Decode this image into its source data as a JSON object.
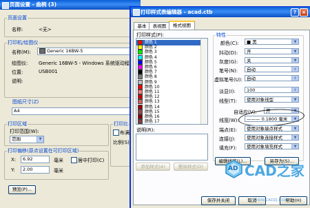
{
  "bg_window": {
    "title": "页面设置 - 曲柄 (3)",
    "page_setup": {
      "group_label": "页面设置",
      "name_label": "名称:",
      "name_value": "<无>"
    },
    "printer": {
      "group_label": "打印机/绘图仪",
      "name_label": "名称(M):",
      "name_value": "Generic 16BW-5",
      "plotter_label": "绘图仪:",
      "plotter_value": "Generic 16BW-5 - Windows 系统驱动程序 -",
      "location_label": "位置:",
      "location_value": "USB001",
      "desc_label": "说明:"
    },
    "paper_size": {
      "group_label": "图纸尺寸(Z)",
      "value": "A4"
    },
    "plot_area": {
      "group_label": "打印区域",
      "range_label": "打印范围(W):",
      "range_value": "范围"
    },
    "plot_scale": {
      "group_label": "打印比",
      "fit_label": "布满",
      "ratio_label": "比例(S)"
    },
    "plot_offset": {
      "group_label": "打印偏移(原点设置在可打印区域)",
      "x_label": "X:",
      "x_value": "6.92",
      "x_unit": "毫米",
      "y_label": "Y:",
      "y_value": "2.00",
      "y_unit": "毫米",
      "center_label": "居中打印(C)"
    },
    "preview_button": "预览(P)..."
  },
  "fg_window": {
    "title": "打印样式表编辑器 - acad.ctb",
    "title_buttons": {
      "help": "?",
      "close": "×"
    },
    "tabs": [
      "基本",
      "表视图",
      "格式视图"
    ],
    "active_tab": 2,
    "styles_label": "打印样式(P):",
    "styles": [
      {
        "name": "颜色 1",
        "color": "#ff0000",
        "selected": true
      },
      {
        "name": "颜色 2",
        "color": "#ffff00",
        "selected": false
      },
      {
        "name": "颜色 3",
        "color": "#00ff00",
        "selected": false
      },
      {
        "name": "颜色 4",
        "color": "#00ffff",
        "selected": false
      },
      {
        "name": "颜色 5",
        "color": "#0000ff",
        "selected": false
      },
      {
        "name": "颜色 6",
        "color": "#ff00ff",
        "selected": false
      },
      {
        "name": "颜色 7",
        "color": "#000000",
        "selected": false
      },
      {
        "name": "颜色 8",
        "color": "#808080",
        "selected": false
      },
      {
        "name": "颜色 9",
        "color": "#c0c0c0",
        "selected": false
      },
      {
        "name": "颜色 10",
        "color": "#ff0000",
        "selected": false
      },
      {
        "name": "颜色 11",
        "color": "#ff7f7f",
        "selected": false
      },
      {
        "name": "颜色 12",
        "color": "#cc0000",
        "selected": false
      },
      {
        "name": "颜色 13",
        "color": "#cc6666",
        "selected": false
      },
      {
        "name": "颜色 14",
        "color": "#990000",
        "selected": false
      },
      {
        "name": "颜色 15",
        "color": "#994c4c",
        "selected": false
      },
      {
        "name": "颜色 16",
        "color": "#7f0000",
        "selected": false
      },
      {
        "name": "颜色 17",
        "color": "#7f3f3f",
        "selected": false
      }
    ],
    "desc_label": "说明(R):",
    "add_style_button": "添加样式(A)",
    "delete_style_button": "删除样式(D)",
    "properties": {
      "group_label": "特性",
      "color_label": "颜色(C):",
      "color_value": "■ 黑",
      "dither_label": "抖动(D):",
      "dither_value": "开",
      "grayscale_label": "灰度(G):",
      "grayscale_value": "关",
      "pen_label": "笔号(N):",
      "pen_value": "自动",
      "virtual_pen_label": "虚拟笔号(U):",
      "virtual_pen_value": "自动",
      "screening_label": "淡显(I):",
      "screening_value": "100",
      "linetype_label": "线型(T):",
      "linetype_value": "使用对象线型",
      "adaptive_label": "自适应(V):",
      "adaptive_value": "开",
      "lineweight_label": "线宽(W):",
      "lineweight_value": "——— 0.1800 毫米",
      "endstyle_label": "端点(E):",
      "endstyle_value": "使用对象端点样式",
      "joinstyle_label": "连接(J):",
      "joinstyle_value": "使用对象连接样式",
      "fillstyle_label": "填充(F):",
      "fillstyle_value": "使用对象填充样式"
    },
    "edit_lineweights_button": "编辑线宽(L)...",
    "save_as_button": "另存为(S)...",
    "save_close_button": "保存并关闭",
    "cancel_button": "取消",
    "help_button": "帮助(H)"
  },
  "watermark": {
    "logo_text": "CAD之家",
    "logo_badge": "AD",
    "url_text": "WWW.CADZJ.COM"
  }
}
